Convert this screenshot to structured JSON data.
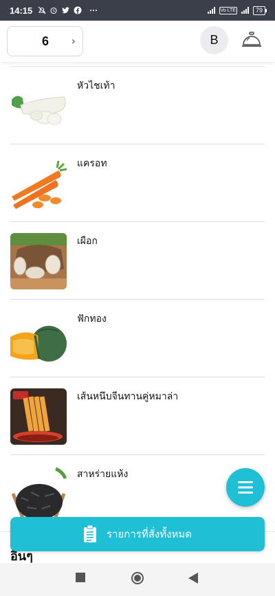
{
  "status_bar": {
    "time": "14:15",
    "battery": "79",
    "volte": "Vo LTE",
    "more": "···"
  },
  "header": {
    "table_number": "6",
    "avatar_letter": "B"
  },
  "menu_items": [
    {
      "name": "หัวไชเท้า",
      "icon": "daikon-radish-photo"
    },
    {
      "name": "แครอท",
      "icon": "carrot-photo"
    },
    {
      "name": "เผือก",
      "icon": "taro-photo"
    },
    {
      "name": "ฟักทอง",
      "icon": "pumpkin-photo"
    },
    {
      "name": "เส้นหนึบจีนทานคู่หมาล่า",
      "icon": "glass-noodle-photo"
    },
    {
      "name": "สาหร่ายแห้ง",
      "icon": "dried-seaweed-photo"
    }
  ],
  "section_label": "อื่นๆ",
  "order_button_label": "รายการที่สั่งทั้งหมด",
  "colors": {
    "accent": "#1fbfd6",
    "status_bar": "#3b3f4a"
  }
}
